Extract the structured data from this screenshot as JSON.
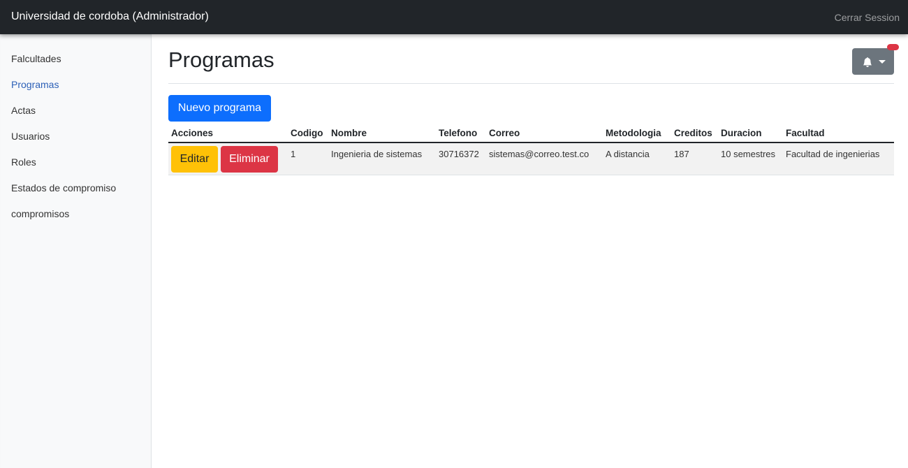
{
  "navbar": {
    "brand": "Universidad de cordoba (Administrador)",
    "logout_label": "Cerrar Session"
  },
  "sidebar": {
    "items": [
      {
        "label": "Falcultades",
        "active": false
      },
      {
        "label": "Programas",
        "active": true
      },
      {
        "label": "Actas",
        "active": false
      },
      {
        "label": "Usuarios",
        "active": false
      },
      {
        "label": "Roles",
        "active": false
      },
      {
        "label": "Estados de compromiso",
        "active": false
      },
      {
        "label": "compromisos",
        "active": false
      }
    ]
  },
  "main": {
    "title": "Programas",
    "notification_icon": "bell-icon",
    "new_button_label": "Nuevo programa",
    "table": {
      "columns": [
        "Acciones",
        "Codigo",
        "Nombre",
        "Telefono",
        "Correo",
        "Metodologia",
        "Creditos",
        "Duracion",
        "Facultad"
      ],
      "edit_label": "Editar",
      "delete_label": "Eliminar",
      "rows": [
        {
          "codigo": "1",
          "nombre": "Ingenieria de sistemas",
          "telefono": "30716372",
          "correo": "sistemas@correo.test.co",
          "metodologia": "A distancia",
          "creditos": "187",
          "duracion": "10 semestres",
          "facultad": "Facultad de ingenierias"
        }
      ]
    }
  },
  "colors": {
    "navbar": "#212529",
    "primary": "#0d6efd",
    "warning": "#ffc107",
    "danger": "#dc3545",
    "secondary": "#6c757d",
    "active_link": "#2c60b7"
  }
}
